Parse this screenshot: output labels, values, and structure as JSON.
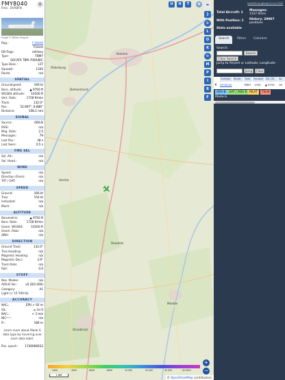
{
  "info": {
    "callsign": "FMY8040",
    "hex": "Hex:  3AABF8",
    "photo_credit": "Image © Willem Verguet",
    "header_rows": [
      {
        "k": "Reg.:",
        "v": "F-HAAA",
        "link": true
      },
      {
        "k": "",
        "v": "France"
      },
      {
        "k": "DB flags:",
        "v": "military"
      },
      {
        "k": "Type:",
        "v": "TBM7"
      },
      {
        "k": "",
        "v": "SOCATA TBM-700A/B/C"
      },
      {
        "k": "Type Desc.:",
        "v": "L1T"
      },
      {
        "k": "Squawk:",
        "v": "1345"
      },
      {
        "k": "Route:",
        "v": "n/a"
      }
    ],
    "sections": [
      {
        "title": "SPATIAL",
        "rows": [
          {
            "k": "Groundspeed:",
            "v": "166 kt"
          },
          {
            "k": "Baro. altitude:",
            "v": "▲ 9750 ft"
          },
          {
            "k": "WGS84 altitude:",
            "v": "10100 ft"
          },
          {
            "k": "Vert. Rate:",
            "v": "1728 ft/min"
          },
          {
            "k": "Track:",
            "v": "132.0°"
          },
          {
            "k": "Pos.:",
            "v": "52.897°, 8.886°"
          },
          {
            "k": "Distance:",
            "v": "108.2 nmi"
          }
        ]
      },
      {
        "title": "SIGNAL",
        "rows": [
          {
            "k": "Source:",
            "v": "ADS-B"
          },
          {
            "k": "RSSI:",
            "v": "n/a"
          },
          {
            "k": "Msg. Rate:",
            "v": "2.5"
          },
          {
            "k": "Messages:",
            "v": "79"
          },
          {
            "k": "",
            "v": ""
          },
          {
            "k": "Last Pos.:",
            "v": "38 s"
          },
          {
            "k": "Last Seen:",
            "v": "0.5 s"
          }
        ]
      },
      {
        "title": "FMS SEL",
        "rows": [
          {
            "k": "Sel. Alt.:",
            "v": "n/a"
          },
          {
            "k": "Sel. Head.:",
            "v": "n/a"
          }
        ]
      },
      {
        "title": "WIND",
        "rows": [
          {
            "k": "Speed:",
            "v": "n/a"
          },
          {
            "k": "Direction (from):",
            "v": "n/a"
          },
          {
            "k": "TAT / OAT:",
            "v": "n/a"
          }
        ]
      },
      {
        "title": "SPEED",
        "rows": [
          {
            "k": "Ground:",
            "v": "166 kt"
          },
          {
            "k": "True:",
            "v": "154 kt"
          },
          {
            "k": "Indicated:",
            "v": "n/a"
          },
          {
            "k": "Mach:",
            "v": "n/a"
          }
        ]
      },
      {
        "title": "ALTITUDE",
        "rows": [
          {
            "k": "Barometric:",
            "v": "▲ 9750 ft"
          },
          {
            "k": "Baro. Rate:",
            "v": "1728 ft/min"
          },
          {
            "k": "Geom. WGS84:",
            "v": "10100 ft"
          },
          {
            "k": "Geom. Rate:",
            "v": "n/a"
          },
          {
            "k": "QNH:",
            "v": "n/a"
          }
        ]
      },
      {
        "title": "DIRECTION",
        "rows": [
          {
            "k": "Ground Track:",
            "v": "132.0°"
          },
          {
            "k": "True Heading:",
            "v": "n/a"
          },
          {
            "k": "Magnetic Heading:",
            "v": "n/a"
          },
          {
            "k": "Magnetic Decl.:",
            "v": "3.9°"
          },
          {
            "k": "Track Rate:",
            "v": "n/a"
          },
          {
            "k": "Roll:",
            "v": "0.0"
          }
        ]
      },
      {
        "title": "STUFF",
        "rows": [
          {
            "k": "Nav. Modes:",
            "v": "n/a"
          },
          {
            "k": "ADS-B Ver.:",
            "v": "v0 (DO-260)"
          },
          {
            "k": "Category:",
            "v": "A1"
          },
          {
            "k": "Light (< 15 500 lb)",
            "v": ""
          }
        ]
      },
      {
        "title": "ACCURACY",
        "rows": [
          {
            "k": "NACₚ",
            "v": "EPU < 92 m"
          },
          {
            "k": "SIL:",
            "v": "≤ 1e-5"
          },
          {
            "k": "NACᵥ:",
            "v": "< 3 m/s"
          },
          {
            "k": "NICᵇᵃʳᵒ:",
            "v": "n/a"
          },
          {
            "k": "Rᶜ:",
            "v": "186 m"
          }
        ]
      }
    ],
    "footer_note": "Learn more about Mode S data type by hovering over each data label.",
    "pos_epoch": {
      "k": "Pos. epoch:",
      "v": "1740066633"
    }
  },
  "map": {
    "buttons": [
      "U",
      "H",
      "T"
    ],
    "side_buttons": [
      "L",
      "O",
      "K",
      "M",
      "P",
      "I",
      "R",
      "F"
    ],
    "cities": [
      {
        "name": "Bremen"
      },
      {
        "name": "Delmenhorst"
      },
      {
        "name": "Oldenburg"
      },
      {
        "name": "Vechta"
      },
      {
        "name": "Diepholz"
      },
      {
        "name": "Osnabrück"
      },
      {
        "name": "Minden"
      }
    ],
    "legend_ticks": [
      "2000",
      "4000",
      "6000",
      "8000",
      "10 000",
      "20 000",
      "30 000",
      "40 000+"
    ],
    "scale_label": "1 NM",
    "attribution_prefix": "©",
    "attribution_link": "OpenStreetMap",
    "attribution_suffix": "contributors."
  },
  "right": {
    "version_link": "tar1090 on github (3.14.1733)",
    "stats": {
      "total_aircraft": "Total Aircraft: 1",
      "with_position": "With Position: 1",
      "stats_available": "Stats available",
      "messages": "Messages:",
      "messages_rate": "1337.9/sec",
      "history": "History: 29907",
      "history_suffix": "positions"
    },
    "tabs": [
      "Search",
      "Filters",
      "Columns"
    ],
    "search": {
      "label": "Search:",
      "button": "Search",
      "clear_button": "Clear Search",
      "jump_label": "Jump to Airport or Latitude, Longitude:",
      "jump_button": "Jump",
      "clear": "Clear"
    },
    "table": {
      "headers": [
        "Callsign",
        "Route",
        "Type",
        "Squawk",
        "Alt. (ft)",
        "Sp"
      ],
      "row": [
        "FMY8040",
        "",
        "TBM7",
        "1345",
        "▲ 9750",
        "16"
      ]
    },
    "badges": [
      {
        "label": "ADS-B",
        "color": "#7dc7ff"
      },
      {
        "label": "UAT / ADS-R",
        "color": "#9be07b"
      },
      {
        "label": "MLAT",
        "color": "#ffcf5c"
      },
      {
        "label": "TIS-B",
        "color": "#ff8f7d"
      }
    ],
    "modes_label": "Mode-S"
  },
  "colors": {
    "accent": "#2d65b8",
    "panel": "#2b3a4e",
    "section": "#cfe0f4"
  }
}
